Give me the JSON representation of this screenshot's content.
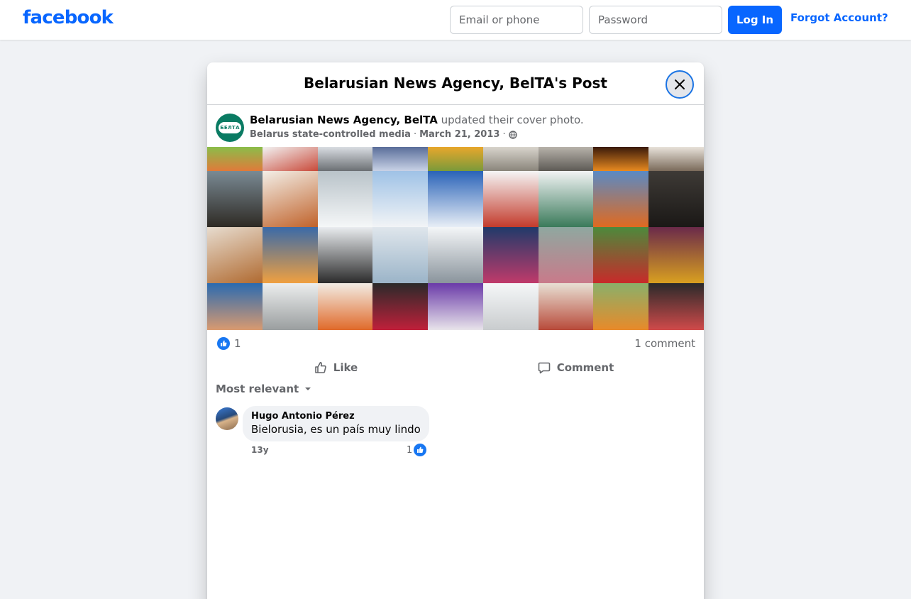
{
  "topbar": {
    "logo": "facebook",
    "email_placeholder": "Email or phone",
    "password_placeholder": "Password",
    "login_label": "Log In",
    "forgot_label": "Forgot Account?"
  },
  "modal": {
    "title": "Belarusian News Agency, BelTA's Post",
    "close_icon": "close-icon"
  },
  "post": {
    "avatar_text": "БЕЛТА",
    "author": "Belarusian News Agency, BelTA",
    "action": " updated their cover photo.",
    "label": "Belarus state-controlled media",
    "separator": "·",
    "date": "March 21, 2013",
    "privacy_icon": "globe-icon",
    "like_count": "1",
    "comment_count": "1 comment"
  },
  "actions": {
    "like_label": "Like",
    "comment_label": "Comment",
    "sort_label": "Most relevant"
  },
  "comment": {
    "author": "Hugo Antonio Pérez",
    "text": "Bielorusia, es un país muy lindo",
    "time": "13y",
    "reaction_count": "1"
  },
  "colors": {
    "brand": "#0866ff",
    "background": "#f0f2f5",
    "secondary_text": "#65676b"
  }
}
